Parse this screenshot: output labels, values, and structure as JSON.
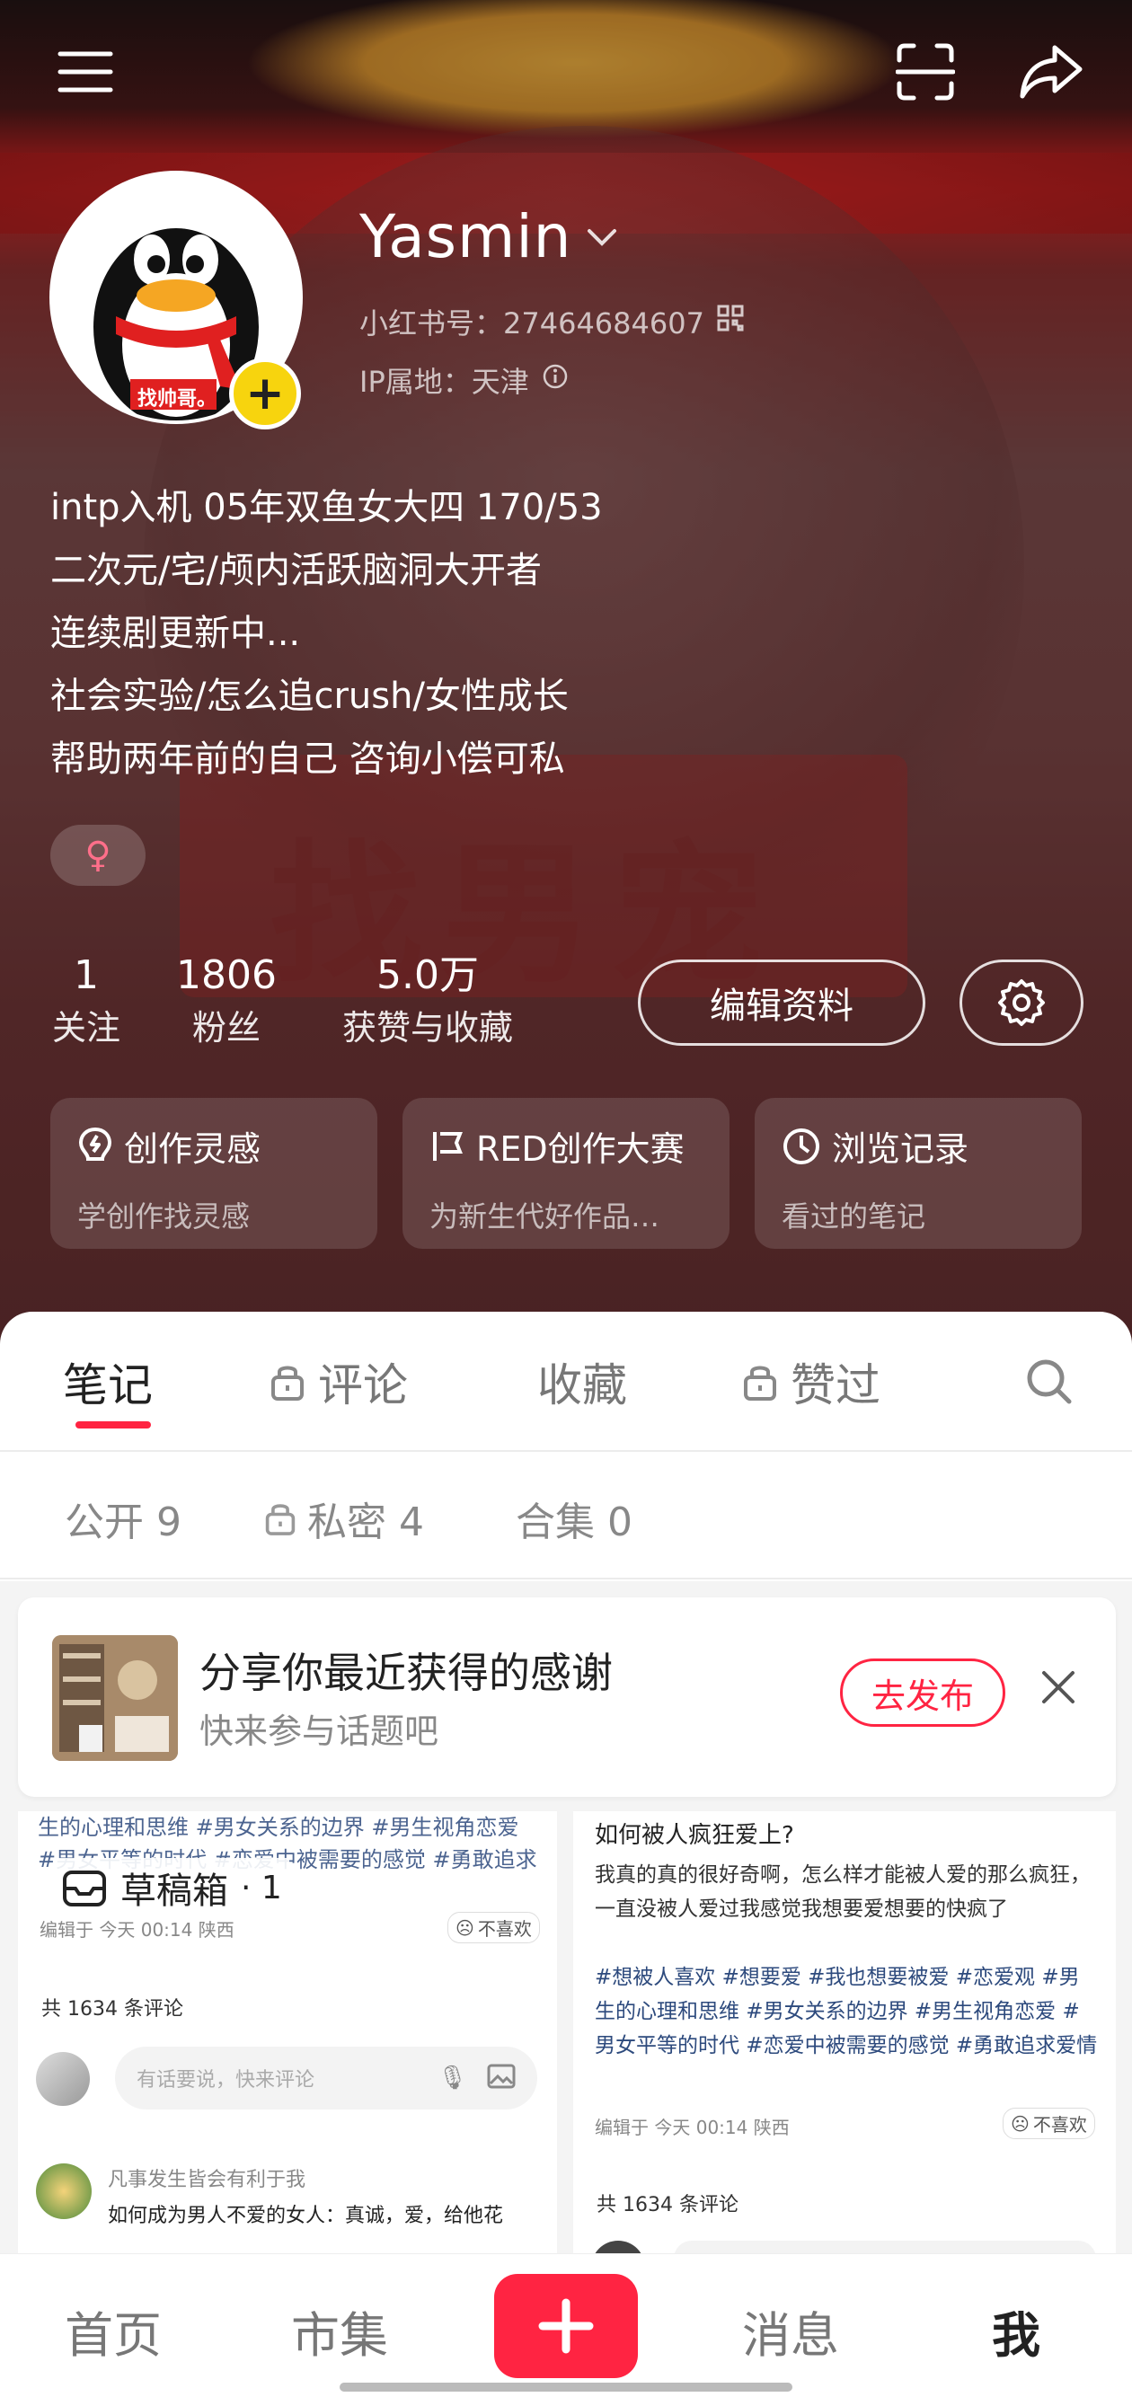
{
  "profile": {
    "username": "Yasmin",
    "id_label": "小红书号：27464684607",
    "ip_label": "IP属地：天津",
    "bio_lines": [
      "intp入机  05年双鱼女大四 170/53",
      "二次元/宅/颅内活跃脑洞大开者",
      "连续剧更新中...",
      "社会实验/怎么追crush/女性成长",
      "帮助两年前的自己 咨询小偿可私"
    ],
    "gender": "♀",
    "avatar_caption": "找帅哥。",
    "avatar_plus": "+"
  },
  "background": {
    "sign_text": "找男宠"
  },
  "stats": [
    {
      "num": "1",
      "label": "关注"
    },
    {
      "num": "1806",
      "label": "粉丝"
    },
    {
      "num": "5.0万",
      "label": "获赞与收藏"
    }
  ],
  "actions": {
    "edit_label": "编辑资料"
  },
  "cards": [
    {
      "title": "创作灵感",
      "sub": "学创作找灵感",
      "icon": "bulb-icon"
    },
    {
      "title": "RED创作大赛",
      "sub": "为新生代好作品…",
      "icon": "flag-icon"
    },
    {
      "title": "浏览记录",
      "sub": "看过的笔记",
      "icon": "clock-icon"
    }
  ],
  "tabs": [
    "笔记",
    "评论",
    "收藏",
    "赞过"
  ],
  "subtabs": [
    "公开 9",
    "私密 4",
    "合集 0"
  ],
  "promo": {
    "title": "分享你最近获得的感谢",
    "sub": "快来参与话题吧",
    "button": "去发布"
  },
  "drafts": {
    "label": "草稿箱",
    "count": "· 1"
  },
  "note_left": {
    "top_text": "生的心理和思维 #男女关系的边界 #男生视角恋爱 #男女平等的时代 #恋爱中被需要的感觉 #勇敢追求",
    "meta": "编辑于 今天 00:14 陕西",
    "dislike": "不喜欢",
    "comments": "共 1634 条评论",
    "input_placeholder": "有话要说，快来评论",
    "commenter": "凡事发生皆会有利于我",
    "comment": "如何成为男人不爱的女人：真诚，爱，给他花"
  },
  "note_right": {
    "title": "如何被人疯狂爱上?",
    "body": "我真的真的很好奇啊，怎么样才能被人爱的那么疯狂，一直没被人爱过我感觉我想要爱想要的快疯了",
    "hashtags": "#想被人喜欢 #想要爱 #我也想要被爱 #恋爱观 #男生的心理和思维 #男女关系的边界 #男生视角恋爱 #男女平等的时代 #恋爱中被需要的感觉 #勇敢追求爱情",
    "meta": "编辑于 今天 00:14 陕西",
    "dislike": "不喜欢",
    "comments": "共 1634 条评论"
  },
  "bottom_nav": [
    "首页",
    "市集",
    "消息",
    "我"
  ],
  "colors": {
    "accent": "#ff2442",
    "badge": "#f7d40e"
  }
}
